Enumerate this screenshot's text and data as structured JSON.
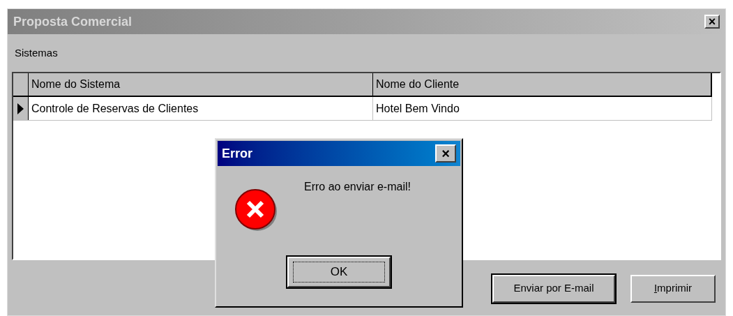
{
  "window": {
    "title": "Proposta Comercial",
    "close": "×"
  },
  "menu": [
    {
      "label": "Sistemas"
    }
  ],
  "table": {
    "columns": [
      "Nome do Sistema",
      "Nome do Cliente"
    ],
    "rows": [
      {
        "cells": [
          "Controle de Reservas de Clientes",
          "Hotel Bem Vindo"
        ],
        "selected": true
      }
    ]
  },
  "buttons": [
    {
      "label": "Enviar por E-mail",
      "default": true,
      "accelerator": false
    },
    {
      "label": "Imprimir",
      "default": false,
      "accelerator": true
    }
  ],
  "dialog": {
    "title": "Error",
    "close": "×",
    "message": "Erro ao enviar e-mail!",
    "button": {
      "label": "OK",
      "focused": true
    }
  }
}
